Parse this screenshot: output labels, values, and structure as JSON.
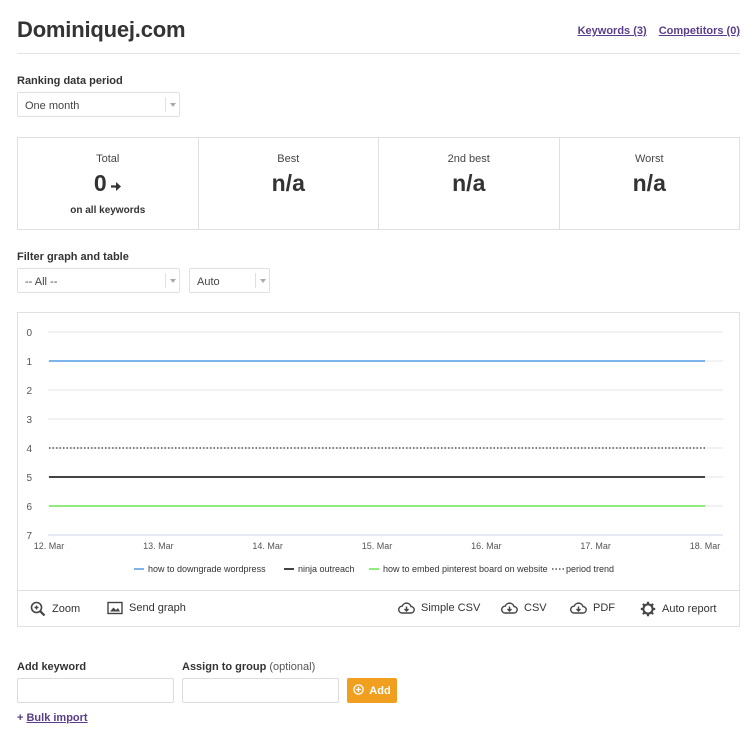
{
  "header": {
    "title": "Dominiquej.com",
    "keywords_link": "Keywords (3)",
    "competitors_link": "Competitors (0)"
  },
  "period": {
    "label": "Ranking data period",
    "selected": "One month"
  },
  "stats": [
    {
      "label": "Total",
      "value": "0",
      "sub": "on all keywords"
    },
    {
      "label": "Best",
      "value": "n/a",
      "sub": ""
    },
    {
      "label": "2nd best",
      "value": "n/a",
      "sub": ""
    },
    {
      "label": "Worst",
      "value": "n/a",
      "sub": ""
    }
  ],
  "filter": {
    "label": "Filter graph and table",
    "selected": "-- All --",
    "mode": "Auto"
  },
  "chart_data": {
    "type": "line",
    "x": [
      "12. Mar",
      "13. Mar",
      "14. Mar",
      "15. Mar",
      "16. Mar",
      "17. Mar",
      "18. Mar"
    ],
    "ylim": [
      0,
      7
    ],
    "yticks": [
      "0",
      "1",
      "2",
      "3",
      "4",
      "5",
      "6",
      "7"
    ],
    "y_reversed": true,
    "grid": true,
    "legend_position": "bottom",
    "series": [
      {
        "name": "how to downgrade wordpress",
        "values": [
          1,
          1,
          1,
          1,
          1,
          1,
          1
        ],
        "color": "#7cb5ec",
        "style": "solid"
      },
      {
        "name": "ninja outreach",
        "values": [
          5,
          5,
          5,
          5,
          5,
          5,
          5
        ],
        "color": "#434348",
        "style": "solid"
      },
      {
        "name": "how to embed pinterest board on website",
        "values": [
          6,
          6,
          6,
          6,
          6,
          6,
          6
        ],
        "color": "#90ed7d",
        "style": "solid"
      },
      {
        "name": "period trend",
        "values": [
          4,
          4,
          4,
          4,
          4,
          4,
          4
        ],
        "color": "#555555",
        "style": "dotted"
      }
    ]
  },
  "toolbar": {
    "zoom": "Zoom",
    "send_graph": "Send graph",
    "simple_csv": "Simple CSV",
    "csv": "CSV",
    "pdf": "PDF",
    "auto_report": "Auto report"
  },
  "add_keyword": {
    "keyword_label": "Add keyword",
    "group_label": "Assign to group",
    "group_optional": "(optional)",
    "add_button": "Add",
    "bulk_prefix": "+ ",
    "bulk_link": "Bulk import"
  },
  "colors": {
    "accent": "#f0a01e",
    "link": "#5a3d8a"
  }
}
